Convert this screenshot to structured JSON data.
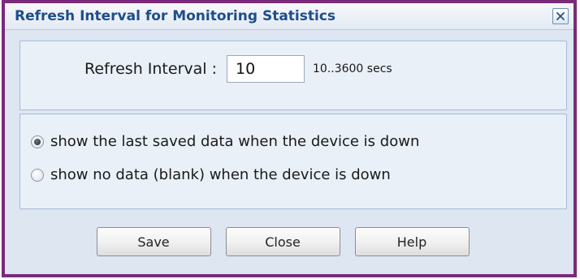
{
  "dialog": {
    "title": "Refresh Interval for Monitoring Statistics",
    "close_icon": "close-x-icon",
    "accent_color": "#7a2a7a",
    "title_color": "#1d4d8c"
  },
  "interval": {
    "label": "Refresh Interval :",
    "value": "10",
    "range_hint": "10..3600 secs"
  },
  "options": [
    {
      "label": "show the last saved data when the device is down",
      "checked": true
    },
    {
      "label": "show no data (blank) when the device is down",
      "checked": false
    }
  ],
  "buttons": {
    "save": "Save",
    "close": "Close",
    "help": "Help"
  }
}
